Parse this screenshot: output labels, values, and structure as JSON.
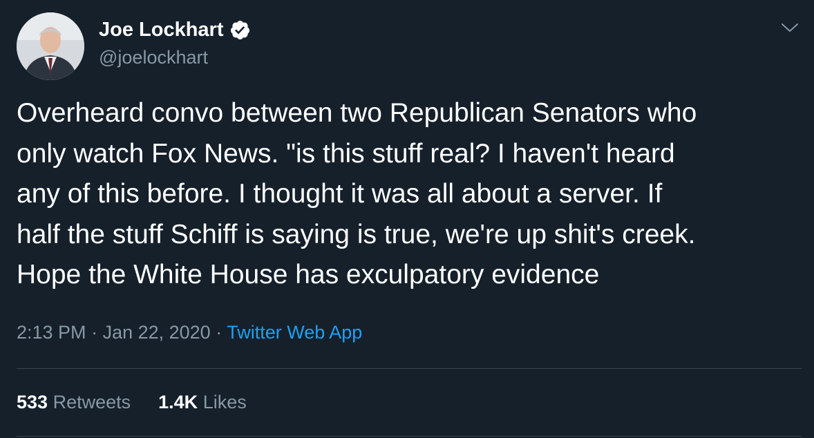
{
  "author": {
    "display_name": "Joe Lockhart",
    "handle": "@joelockhart",
    "verified_icon": "verified-badge-icon",
    "avatar_icon": "profile-photo"
  },
  "tweet": {
    "text": "Overheard convo between two Republican Senators who\nonly watch Fox News. \"is this stuff real? I haven't heard\nany of this before. I thought it was all about a server.  If\nhalf the stuff Schiff is saying is true, we're up shit's creek.\nHope the White House has exculpatory evidence"
  },
  "meta": {
    "time": "2:13 PM",
    "separator": " · ",
    "date": "Jan 22, 2020",
    "source": "Twitter Web App"
  },
  "stats": {
    "retweets_count": "533",
    "retweets_label": "Retweets",
    "likes_count": "1.4K",
    "likes_label": "Likes"
  },
  "colors": {
    "background": "#15202b",
    "text_primary": "#ffffff",
    "text_secondary": "#8899a6",
    "link": "#1da1f2",
    "divider": "#38444d"
  }
}
